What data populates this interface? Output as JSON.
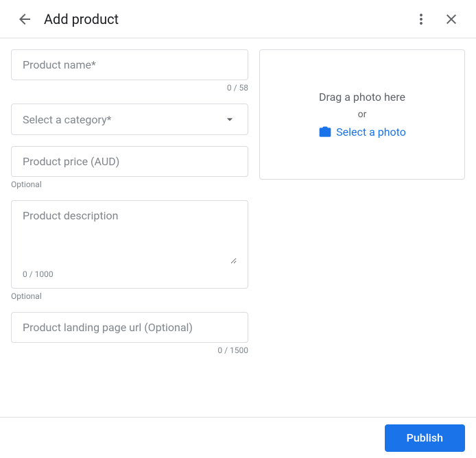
{
  "header": {
    "title": "Add product",
    "back_icon": "←",
    "more_icon": "⋮",
    "close_icon": "✕"
  },
  "form": {
    "product_name": {
      "placeholder": "Product name*",
      "value": "",
      "char_count": "0 / 58"
    },
    "category": {
      "placeholder": "Select a category*"
    },
    "product_price": {
      "placeholder": "Product price (AUD)",
      "value": "",
      "optional_label": "Optional"
    },
    "product_description": {
      "placeholder": "Product description",
      "value": "",
      "char_count": "0 / 1000",
      "optional_label": "Optional"
    },
    "landing_page_url": {
      "placeholder": "Product landing page url (Optional)",
      "value": "",
      "char_count": "0 / 1500"
    }
  },
  "photo_upload": {
    "drag_text": "Drag a photo here",
    "or_text": "or",
    "select_text": "Select a photo"
  },
  "footer": {
    "publish_label": "Publish"
  }
}
